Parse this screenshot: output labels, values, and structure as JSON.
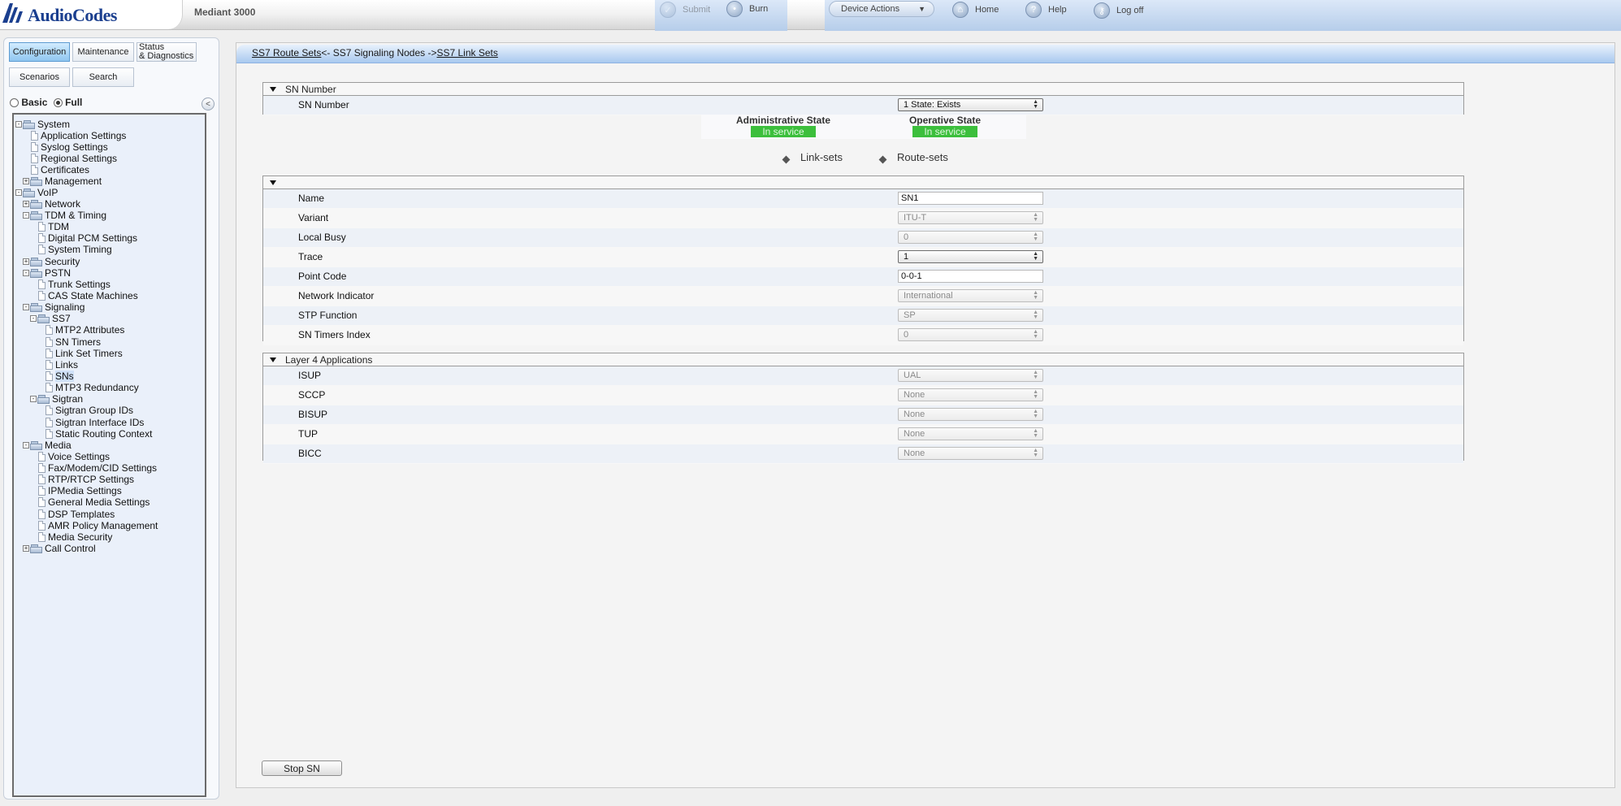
{
  "app": {
    "logo_text": "AudioCodes",
    "device_name": "Mediant 3000"
  },
  "toolbar": {
    "submit": "Submit",
    "burn": "Burn",
    "device_actions": "Device Actions",
    "home": "Home",
    "help": "Help",
    "logoff": "Log off"
  },
  "nav": {
    "tabs": {
      "configuration": "Configuration",
      "maintenance": "Maintenance",
      "status_line1": "Status",
      "status_line2": "& Diagnostics",
      "scenarios": "Scenarios",
      "search": "Search"
    },
    "mode_basic": "Basic",
    "mode_full": "Full",
    "mode_selected": "Full",
    "tree": [
      "System",
      "Application Settings",
      "Syslog Settings",
      "Regional Settings",
      "Certificates",
      "Management",
      "VoIP",
      "Network",
      "TDM & Timing",
      "TDM",
      "Digital PCM Settings",
      "System Timing",
      "Security",
      "PSTN",
      "Trunk Settings",
      "CAS State Machines",
      "Signaling",
      "SS7",
      "MTP2 Attributes",
      "SN Timers",
      "Link Set Timers",
      "Links",
      "SNs",
      "MTP3 Redundancy",
      "Sigtran",
      "Sigtran Group IDs",
      "Sigtran Interface IDs",
      "Static Routing Context",
      "Media",
      "Voice Settings",
      "Fax/Modem/CID Settings",
      "RTP/RTCP Settings",
      "IPMedia Settings",
      "General Media Settings",
      "DSP Templates",
      "AMR Policy Management",
      "Media Security",
      "Call Control"
    ],
    "selected_item": "SNs"
  },
  "breadcrumb": {
    "left_link": "SS7 Route Sets",
    "middle": "<- SS7 Signaling Nodes ->",
    "right_link": "SS7 Link Sets"
  },
  "sn_section": {
    "title": "SN Number",
    "field_label": "SN Number",
    "field_value": "1 State: Exists"
  },
  "state": {
    "admin_label": "Administrative State",
    "admin_value": "In service",
    "oper_label": "Operative State",
    "oper_value": "In service"
  },
  "links": {
    "link_sets": "Link-sets",
    "route_sets": "Route-sets"
  },
  "params": [
    {
      "label": "Name",
      "value": "SN1"
    },
    {
      "label": "Variant",
      "value": "ITU-T"
    },
    {
      "label": "Local Busy",
      "value": "0"
    },
    {
      "label": "Trace",
      "value": "1"
    },
    {
      "label": "Point Code",
      "value": "0-0-1"
    },
    {
      "label": "Network Indicator",
      "value": "International"
    },
    {
      "label": "STP Function",
      "value": "SP"
    },
    {
      "label": "SN Timers Index",
      "value": "0"
    }
  ],
  "layer4": {
    "title": "Layer 4 Applications",
    "rows": [
      {
        "label": "ISUP",
        "value": "UAL"
      },
      {
        "label": "SCCP",
        "value": "None"
      },
      {
        "label": "BISUP",
        "value": "None"
      },
      {
        "label": "TUP",
        "value": "None"
      },
      {
        "label": "BICC",
        "value": "None"
      }
    ]
  },
  "actions": {
    "stop_sn": "Stop SN"
  },
  "colors": {
    "status_green": "#3cbf3c",
    "toolbar_blue": "#b6cdea",
    "tab_active": "#8fc6f0"
  }
}
